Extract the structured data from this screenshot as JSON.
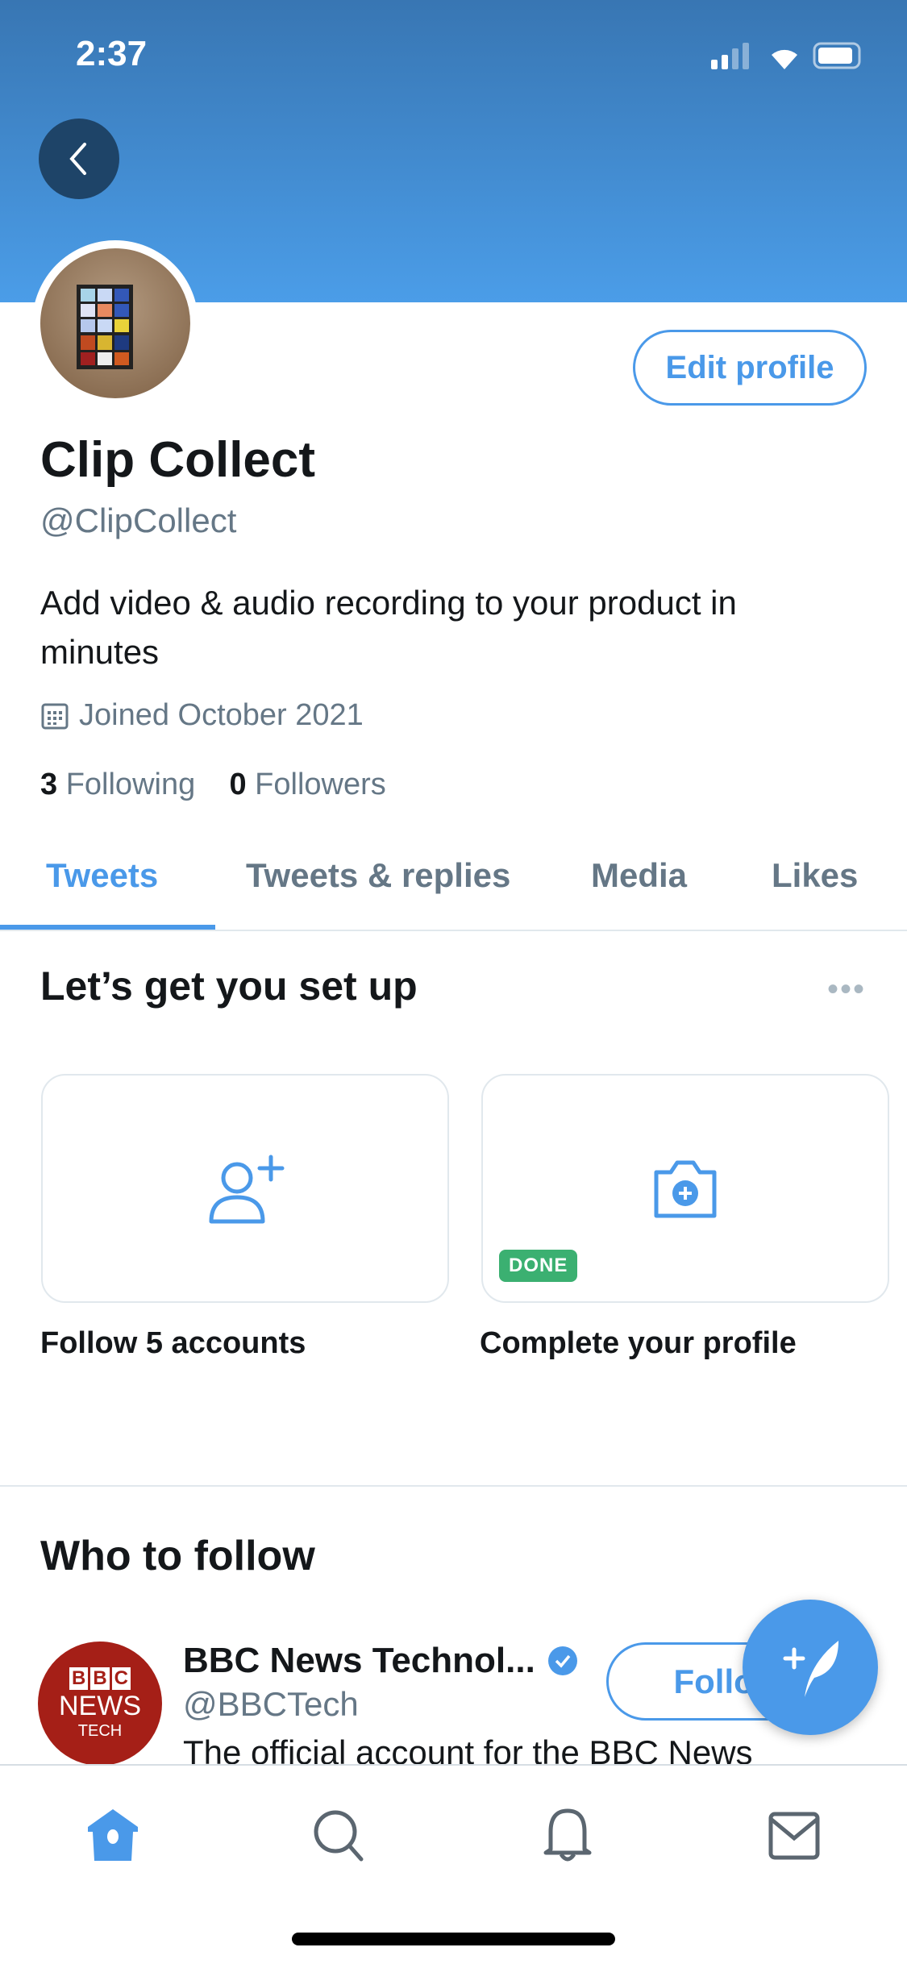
{
  "status_bar": {
    "time": "2:37"
  },
  "profile": {
    "name": "Clip Collect",
    "handle": "@ClipCollect",
    "bio_line1": "Add video & audio recording to your product in",
    "bio_line2": "minutes",
    "joined": "Joined October 2021",
    "following_count": "3",
    "following_label": "Following",
    "followers_count": "0",
    "followers_label": "Followers",
    "edit_label": "Edit profile"
  },
  "tabs": [
    {
      "label": "Tweets",
      "active": true
    },
    {
      "label": "Tweets & replies"
    },
    {
      "label": "Media"
    },
    {
      "label": "Likes"
    }
  ],
  "setup": {
    "title": "Let’s get you set up",
    "more": "•••",
    "cards": [
      {
        "label": "Follow 5 accounts",
        "icon": "add-user-icon"
      },
      {
        "label": "Complete your profile",
        "icon": "camera-plus-icon",
        "badge": "DONE"
      }
    ]
  },
  "who_to_follow": {
    "title": "Who to follow",
    "accounts": [
      {
        "name": "BBC News Technol...",
        "verified": true,
        "handle": "@BBCTech",
        "description": "The official account for the BBC News",
        "follow_label": "Follow",
        "avatar_logo": [
          "BBC",
          "NEWS",
          "TECH"
        ]
      }
    ]
  },
  "nav": [
    "home-icon",
    "search-icon",
    "notifications-icon",
    "messages-icon"
  ],
  "colors": {
    "accent": "#4a99e9",
    "done": "#3bb071",
    "bbc": "#a51f17"
  }
}
